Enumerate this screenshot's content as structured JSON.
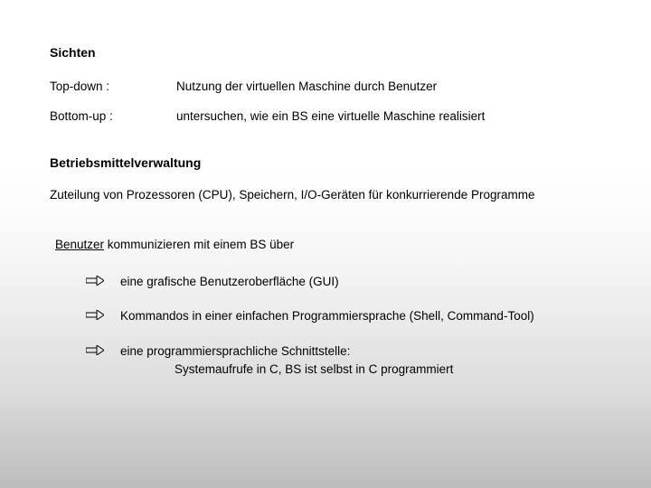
{
  "section1": {
    "heading": "Sichten",
    "row1": {
      "label": "Top-down :",
      "value": "Nutzung der virtuellen Maschine durch Benutzer"
    },
    "row2": {
      "label": "Bottom-up :",
      "value": "untersuchen, wie ein BS eine virtuelle Maschine realisiert"
    }
  },
  "section2": {
    "heading": "Betriebsmittelverwaltung",
    "text": "Zuteilung von Prozessoren (CPU), Speichern, I/O-Geräten für konkurrierende Programme"
  },
  "section3": {
    "heading_underlined": "Benutzer",
    "heading_rest": "  kommunizieren mit einem BS über",
    "bullets": [
      "eine grafische Benutzeroberfläche (GUI)",
      "Kommandos in einer einfachen Programmiersprache (Shell, Command-Tool)",
      "eine programmiersprachliche Schnittstelle:"
    ],
    "bullet3_line2": "Systemaufrufe in C,    BS ist selbst in C programmiert"
  }
}
